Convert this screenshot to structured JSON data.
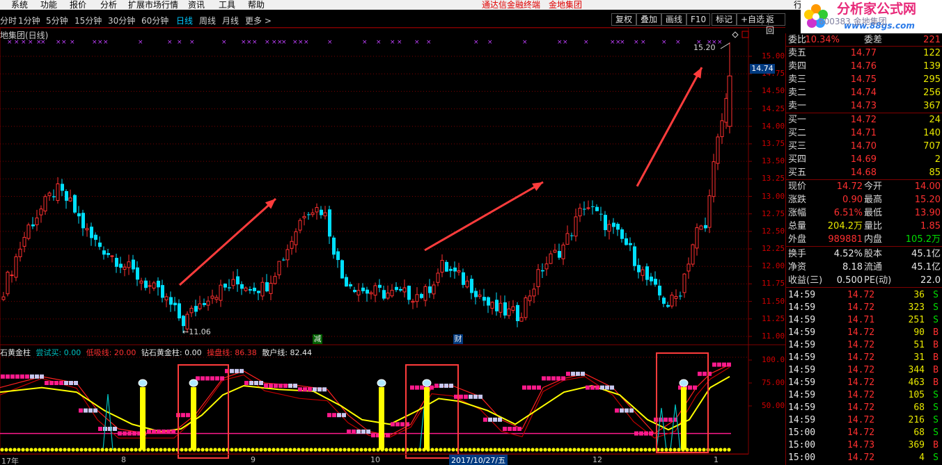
{
  "menu": {
    "items": [
      "系统",
      "功能",
      "报价",
      "分析",
      "扩展市场行情",
      "资讯",
      "工具",
      "帮助"
    ],
    "center_title_1": "通达信金融终端",
    "center_title_2": "金地集团",
    "right_item": "行",
    "logo_text": "分析家公式网",
    "logo_url_text": "www.88gs.com",
    "stock_header": "600383 金地集团"
  },
  "period_bar": {
    "items": [
      "分时",
      "1分钟",
      "5分钟",
      "15分钟",
      "30分钟",
      "60分钟",
      "日线",
      "周线",
      "月线",
      "更多 >"
    ],
    "active": "日线",
    "tools": [
      "复权",
      "叠加",
      "画线",
      "F10",
      "标记",
      "+自选",
      "返回"
    ]
  },
  "chart_title": "地集团(日线)",
  "current_price_tag": "14.74",
  "high_label": "15.20",
  "low_label": "←11.06",
  "event_badges": [
    "减",
    "财"
  ],
  "y_axis_labels": [
    "15.00",
    "14.75",
    "14.50",
    "14.25",
    "14.00",
    "13.75",
    "13.50",
    "13.25",
    "13.00",
    "12.75",
    "12.50",
    "12.25",
    "12.00",
    "11.75",
    "11.50",
    "11.25",
    "11.00"
  ],
  "sub_y_axis_labels": [
    "100.0",
    "75.00",
    "50.00"
  ],
  "sub_legend": {
    "name": "石黄金柱",
    "items": [
      {
        "text": "尝试买: 0.00",
        "color": "#00c0c0"
      },
      {
        "text": "低吸线: 20.00",
        "color": "#ff3030"
      },
      {
        "text": "钻石黄金柱: 0.00",
        "color": "#e8e8e8"
      },
      {
        "text": "操盘线: 86.38",
        "color": "#ff3030"
      },
      {
        "text": "散户线: 82.44",
        "color": "#e8e8e8"
      }
    ]
  },
  "x_axis": {
    "ticks": [
      {
        "label": "17年"
      },
      {
        "label": "8"
      },
      {
        "label": "9"
      },
      {
        "label": "10"
      },
      {
        "label": "12"
      },
      {
        "label": "1"
      }
    ],
    "cursor_date": "2017/10/27/五"
  },
  "quote_panel": {
    "weibi": {
      "label": "委比",
      "value": "10.34%",
      "label2": "委差",
      "value2": "221"
    },
    "asks": [
      {
        "label": "卖五",
        "price": "14.77",
        "vol": "122"
      },
      {
        "label": "卖四",
        "price": "14.76",
        "vol": "139"
      },
      {
        "label": "卖三",
        "price": "14.75",
        "vol": "295"
      },
      {
        "label": "卖二",
        "price": "14.74",
        "vol": "256"
      },
      {
        "label": "卖一",
        "price": "14.73",
        "vol": "367"
      }
    ],
    "bids": [
      {
        "label": "买一",
        "price": "14.72",
        "vol": "24"
      },
      {
        "label": "买二",
        "price": "14.71",
        "vol": "140"
      },
      {
        "label": "买三",
        "price": "14.70",
        "vol": "707"
      },
      {
        "label": "买四",
        "price": "14.69",
        "vol": "2"
      },
      {
        "label": "买五",
        "price": "14.68",
        "vol": "85"
      }
    ],
    "stats": [
      {
        "l1": "现价",
        "v1": "14.72",
        "c1": "red",
        "l2": "今开",
        "v2": "14.00",
        "c2": "red"
      },
      {
        "l1": "涨跌",
        "v1": "0.90",
        "c1": "red",
        "l2": "最高",
        "v2": "15.20",
        "c2": "red"
      },
      {
        "l1": "涨幅",
        "v1": "6.51%",
        "c1": "red",
        "l2": "最低",
        "v2": "13.90",
        "c2": "red"
      },
      {
        "l1": "总量",
        "v1": "204.2万",
        "c1": "yel",
        "l2": "量比",
        "v2": "1.85",
        "c2": "red"
      },
      {
        "l1": "外盘",
        "v1": "989881",
        "c1": "red",
        "l2": "内盘",
        "v2": "105.2万",
        "c2": "grn"
      }
    ],
    "stats2": [
      {
        "l1": "换手",
        "v1": "4.52%",
        "l2": "股本",
        "v2": "45.1亿"
      },
      {
        "l1": "净资",
        "v1": "8.18",
        "l2": "流通",
        "v2": "45.1亿"
      },
      {
        "l1": "收益(三)",
        "v1": "0.500",
        "l2": "PE(动)",
        "v2": "22.0"
      }
    ],
    "ticks": [
      {
        "time": "14:59",
        "price": "14.72",
        "vol": "36",
        "side": "S"
      },
      {
        "time": "14:59",
        "price": "14.72",
        "vol": "323",
        "side": "S"
      },
      {
        "time": "14:59",
        "price": "14.71",
        "vol": "251",
        "side": "S"
      },
      {
        "time": "14:59",
        "price": "14.72",
        "vol": "90",
        "side": "B"
      },
      {
        "time": "14:59",
        "price": "14.72",
        "vol": "51",
        "side": "B"
      },
      {
        "time": "14:59",
        "price": "14.72",
        "vol": "31",
        "side": "B"
      },
      {
        "time": "14:59",
        "price": "14.72",
        "vol": "344",
        "side": "B"
      },
      {
        "time": "14:59",
        "price": "14.72",
        "vol": "463",
        "side": "B"
      },
      {
        "time": "14:59",
        "price": "14.72",
        "vol": "105",
        "side": "S"
      },
      {
        "time": "14:59",
        "price": "14.72",
        "vol": "68",
        "side": "S"
      },
      {
        "time": "14:59",
        "price": "14.72",
        "vol": "216",
        "side": "S"
      },
      {
        "time": "15:00",
        "price": "14.72",
        "vol": "68",
        "side": "S"
      },
      {
        "time": "15:00",
        "price": "14.73",
        "vol": "369",
        "side": "B"
      },
      {
        "time": "15:00",
        "price": "14.72",
        "vol": "4",
        "side": "S"
      }
    ]
  },
  "colors": {
    "up": "#ff3030",
    "down": "#00e0ff",
    "grid": "#800000",
    "gold": "#ffff00",
    "magenta": "#ff1a8c",
    "lavender": "#c8c8f0",
    "annotation": "#ff3c3c"
  }
}
